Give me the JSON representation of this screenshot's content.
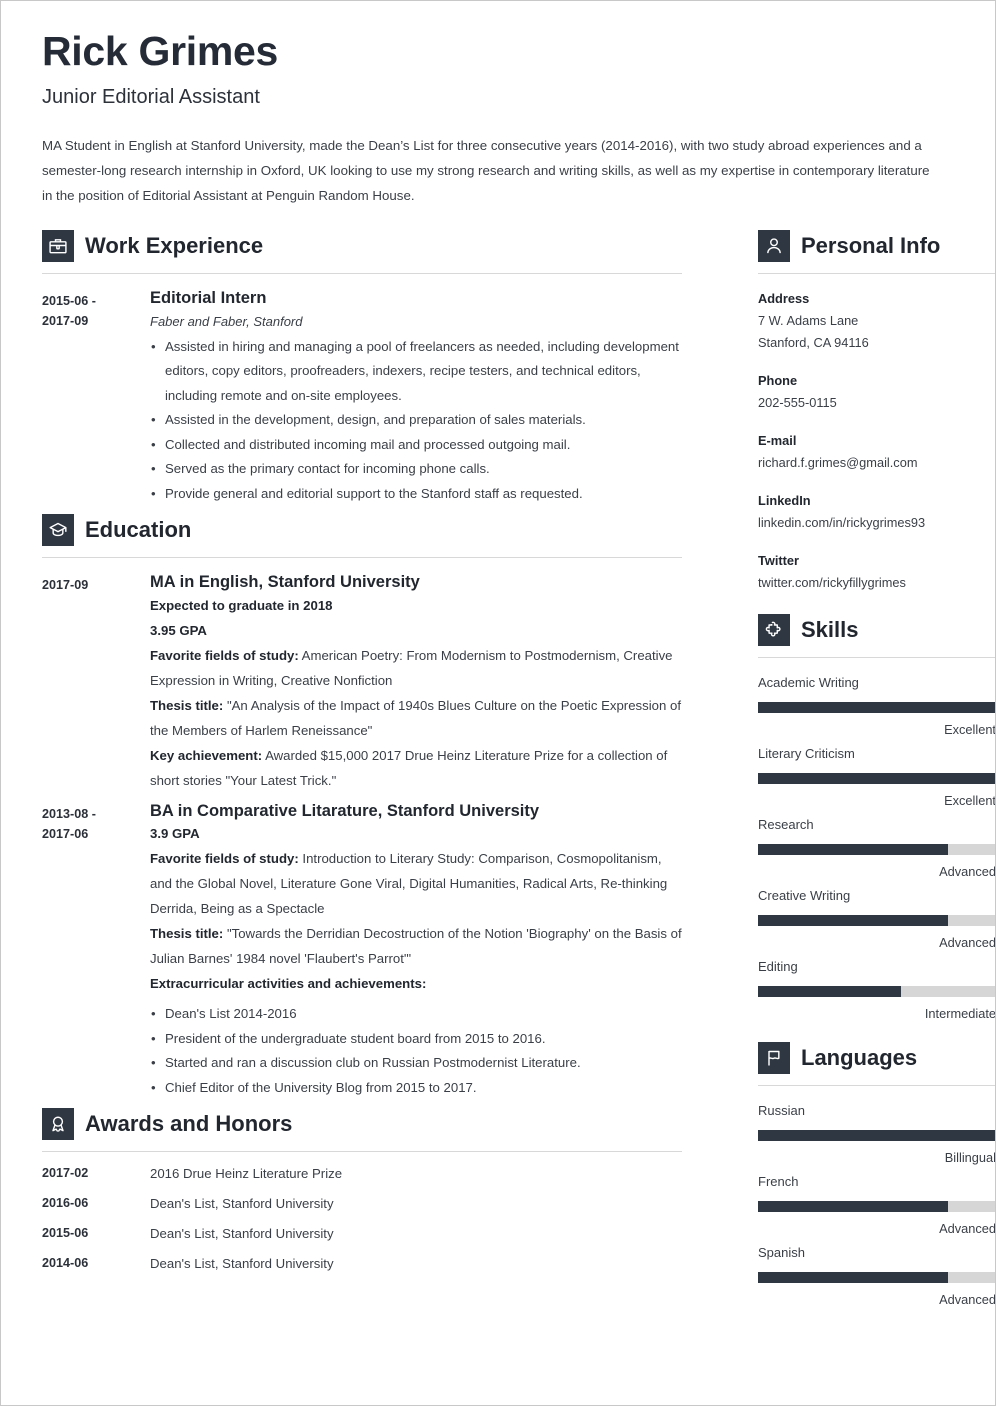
{
  "header": {
    "name": "Rick Grimes",
    "job_title": "Junior Editorial Assistant",
    "summary": "MA Student in English at Stanford University, made the Dean’s List for three consecutive years (2014-2016), with two study abroad experiences and a semester-long research internship in Oxford, UK looking to use my strong research and writing skills, as well as my expertise in contemporary literature in the position of Editorial Assistant at Penguin Random House."
  },
  "sections": {
    "work": {
      "title": "Work Experience",
      "icon": "briefcase-icon",
      "entries": [
        {
          "date": "2015-06 -\n2017-09",
          "date_line1": "2015-06 -",
          "date_line2": "2017-09",
          "title": "Editorial Intern",
          "subtitle": "Faber and Faber, Stanford",
          "bullets": [
            "Assisted in hiring and managing a pool of freelancers as needed, including development editors, copy editors, proofreaders, indexers, recipe testers, and technical editors, including remote and on-site employees.",
            "Assisted in the development, design, and preparation of sales materials.",
            "Collected and distributed incoming mail and processed outgoing mail.",
            "Served as the primary contact for incoming phone calls.",
            "Provide general and editorial support to the Stanford staff as requested."
          ]
        }
      ]
    },
    "education": {
      "title": "Education",
      "icon": "graduation-cap-icon",
      "entries": [
        {
          "date_line1": "2017-09",
          "date_line2": "",
          "title": "MA in English, Stanford University",
          "bold_lines": [
            "Expected to graduate in 2018",
            "3.95 GPA"
          ],
          "details": [
            {
              "label": "Favorite fields of study:",
              "text": " American Poetry: From Modernism to Postmodernism, Creative Expression in Writing, Creative Nonfiction"
            },
            {
              "label": "Thesis title:",
              "text": " \"An Analysis of the Impact of 1940s Blues Culture on the Poetic Expression of the Members of Harlem Reneissance\""
            },
            {
              "label": "Key achievement:",
              "text": " Awarded $15,000 2017 Drue Heinz Literature Prize for a collection of short stories \"Your Latest Trick.\""
            }
          ],
          "bullets_heading": "",
          "bullets": []
        },
        {
          "date_line1": "2013-08 -",
          "date_line2": "2017-06",
          "title": "BA in Comparative Litarature, Stanford University",
          "bold_lines": [
            "3.9 GPA"
          ],
          "details": [
            {
              "label": "Favorite fields of study:",
              "text": " Introduction to Literary Study: Comparison, Cosmopolitanism, and the Global Novel, Literature Gone Viral, Digital Humanities, Radical Arts, Re-thinking Derrida, Being as a Spectacle"
            },
            {
              "label": "Thesis title:",
              "text": " \"Towards the Derridian Decostruction of the Notion 'Biography' on the Basis of Julian Barnes' 1984 novel 'Flaubert's Parrot'\""
            }
          ],
          "bullets_heading": "Extracurricular activities and achievements:",
          "bullets": [
            "Dean's List 2014-2016",
            "President of the undergraduate student board from 2015 to 2016.",
            "Started and ran a discussion club on Russian Postmodernist Literature.",
            "Chief Editor of the University Blog from 2015 to 2017."
          ]
        }
      ]
    },
    "awards": {
      "title": "Awards and Honors",
      "icon": "award-ribbon-icon",
      "rows": [
        {
          "date": "2017-02",
          "text": "2016 Drue Heinz Literature Prize"
        },
        {
          "date": "2016-06",
          "text": "Dean's List, Stanford University"
        },
        {
          "date": "2015-06",
          "text": "Dean's List, Stanford University"
        },
        {
          "date": "2014-06",
          "text": "Dean's List, Stanford University"
        }
      ]
    },
    "personal_info": {
      "title": "Personal Info",
      "icon": "person-icon",
      "fields": [
        {
          "label": "Address",
          "values": [
            "7 W. Adams Lane",
            "Stanford, CA 94116"
          ]
        },
        {
          "label": "Phone",
          "values": [
            "202-555-0115"
          ]
        },
        {
          "label": "E-mail",
          "values": [
            "richard.f.grimes@gmail.com"
          ]
        },
        {
          "label": "LinkedIn",
          "values": [
            "linkedin.com/in/rickygrimes93"
          ]
        },
        {
          "label": "Twitter",
          "values": [
            "twitter.com/rickyfillygrimes"
          ]
        }
      ]
    },
    "skills": {
      "title": "Skills",
      "icon": "puzzle-piece-icon",
      "items": [
        {
          "name": "Academic Writing",
          "level": "Excellent",
          "percent": 100
        },
        {
          "name": "Literary Criticism",
          "level": "Excellent",
          "percent": 100
        },
        {
          "name": "Research",
          "level": "Advanced",
          "percent": 80
        },
        {
          "name": "Creative Writing",
          "level": "Advanced",
          "percent": 80
        },
        {
          "name": "Editing",
          "level": "Intermediate",
          "percent": 60
        }
      ]
    },
    "languages": {
      "title": "Languages",
      "icon": "flag-icon",
      "items": [
        {
          "name": "Russian",
          "level": "Billingual",
          "percent": 100
        },
        {
          "name": "French",
          "level": "Advanced",
          "percent": 80
        },
        {
          "name": "Spanish",
          "level": "Advanced",
          "percent": 80
        }
      ]
    }
  },
  "colors": {
    "accent_dark": "#2f3742",
    "text_heading": "#22272f",
    "text_body": "#3a3f47",
    "meter_track": "#d6d6d6",
    "rule": "#d8d8d8"
  }
}
